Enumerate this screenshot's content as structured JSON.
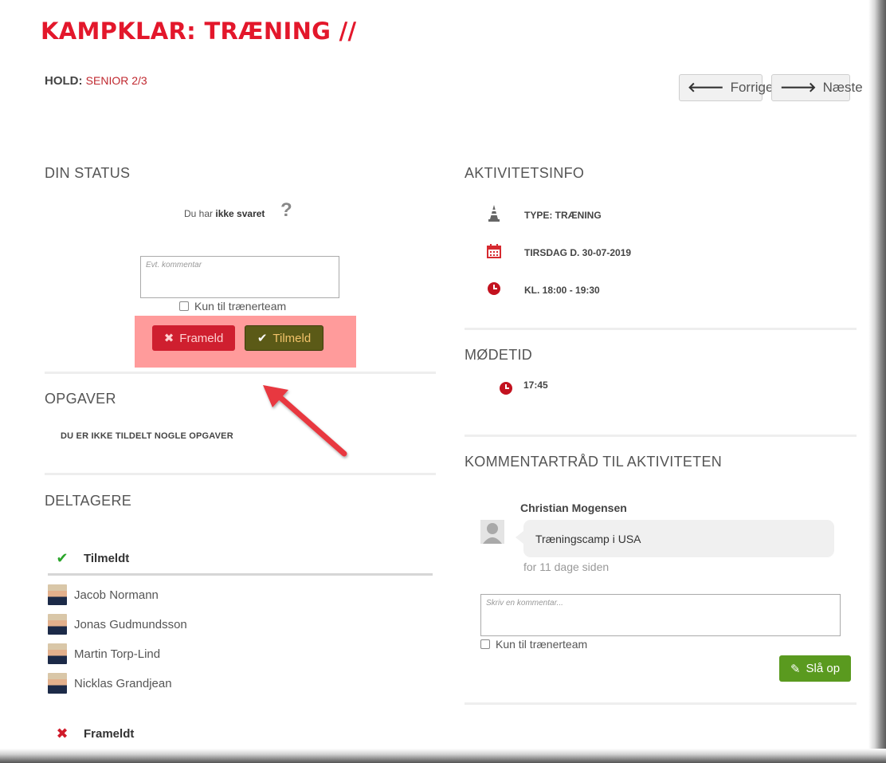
{
  "header": {
    "title": "KAMPKLAR: TRÆNING //",
    "hold_label": "HOLD:",
    "hold_value": "SENIOR 2/3"
  },
  "nav": {
    "prev_label": "Forrige",
    "next_label": "Næste"
  },
  "status": {
    "heading": "DIN STATUS",
    "text_prefix": "Du har ",
    "text_bold": "ikke svaret",
    "comment_placeholder": "Evt. kommentar",
    "trainer_only_label": "Kun til trænerteam",
    "decline_label": "Frameld",
    "accept_label": "Tilmeld"
  },
  "tasks": {
    "heading": "OPGAVER",
    "text": "DU ER IKKE TILDELT NOGLE OPGAVER"
  },
  "participants": {
    "heading": "DELTAGERE",
    "accepted_label": "Tilmeldt",
    "accepted": [
      "Jacob Normann",
      "Jonas Gudmundsson",
      "Martin Torp-Lind",
      "Nicklas Grandjean"
    ],
    "declined_label": "Frameldt"
  },
  "activity": {
    "heading": "AKTIVITETSINFO",
    "type": "TYPE: TRÆNING",
    "date": "TIRSDAG D. 30-07-2019",
    "time": "KL. 18:00 - 19:30"
  },
  "meeting": {
    "heading": "MØDETID",
    "time": "17:45"
  },
  "comments": {
    "heading": "KOMMENTARTRÅD TIL AKTIVITETEN",
    "author": "Christian Mogensen",
    "message": "Træningscamp i USA",
    "time_ago": "for 11 dage siden",
    "placeholder": "Skriv en kommentar...",
    "trainer_only_label": "Kun til trænerteam",
    "post_label": "Slå op"
  },
  "colors": {
    "brand_red": "#e3172b",
    "decline_red": "#cf1f2f",
    "accept_olive": "#5b5a17",
    "post_green": "#5a9a1f",
    "highlight": "#ff9b9b",
    "annotation_arrow": "#e8373f"
  }
}
